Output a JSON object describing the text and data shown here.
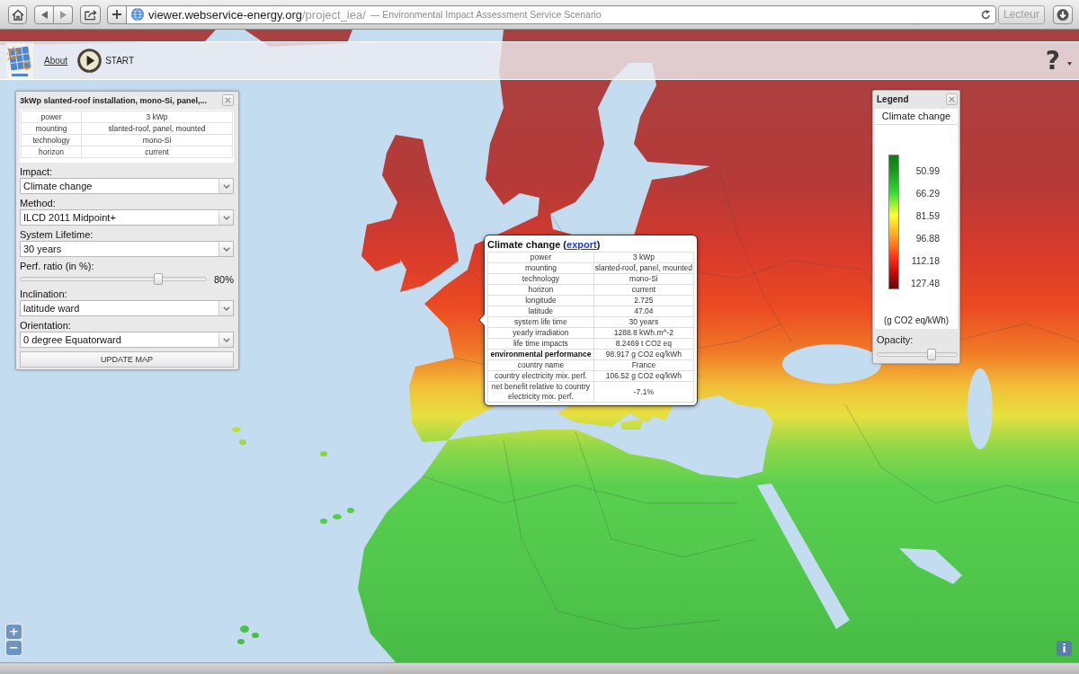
{
  "browser": {
    "address": {
      "host": "viewer.webservice-energy.org",
      "path": "/project_iea/",
      "title": "— Environmental Impact Assessment Service Scenario"
    },
    "reader_button": "Lecteur"
  },
  "header": {
    "about_link": "About",
    "start_button": "START",
    "help_button": "?"
  },
  "settings_panel": {
    "title": "3kWp slanted-roof installation, mono-Si, panel,...",
    "details": [
      {
        "name": "power",
        "value": "3 kWp"
      },
      {
        "name": "mounting",
        "value": "slanted-roof, panel, mounted"
      },
      {
        "name": "technology",
        "value": "mono-Si"
      },
      {
        "name": "horizon",
        "value": "current"
      }
    ],
    "fields": [
      {
        "kind": "select",
        "label": "Impact:",
        "value": "Climate change"
      },
      {
        "kind": "select",
        "label": "Method:",
        "value": "ILCD 2011 Midpoint+"
      },
      {
        "kind": "select",
        "label": "System Lifetime:",
        "value": "30 years"
      },
      {
        "kind": "slider",
        "label": "Perf. ratio (in %):",
        "level": 0.74,
        "reading": "80%"
      },
      {
        "kind": "select",
        "label": "Inclination:",
        "value": "latitude ward"
      },
      {
        "kind": "select",
        "label": "Orientation:",
        "value": "0 degree Equatorward"
      }
    ],
    "button": "UPDATE MAP"
  },
  "popup": {
    "title": "Climate change (",
    "link": "export",
    "title_end": ")",
    "rows": [
      {
        "name": "power",
        "value": "3 kWp",
        "bold": false
      },
      {
        "name": "mounting",
        "value": "slanted-roof, panel, mounted",
        "bold": false
      },
      {
        "name": "technology",
        "value": "mono-Si",
        "bold": false
      },
      {
        "name": "horizon",
        "value": "current",
        "bold": false
      },
      {
        "name": "longitude",
        "value": "2.725",
        "bold": false
      },
      {
        "name": "latitude",
        "value": "47.04",
        "bold": false
      },
      {
        "name": "system life time",
        "value": "30 years",
        "bold": false
      },
      {
        "name": "yearly irradiation",
        "value": "1288.8 kWh.m^-2",
        "bold": false
      },
      {
        "name": "life time impacts",
        "value": "8.2469 t CO2 eq",
        "bold": false
      },
      {
        "name": "environmental performance",
        "value": "98.917 g CO2 eq/kWh",
        "bold": true
      },
      {
        "name": "country name",
        "value": "France",
        "bold": false
      },
      {
        "name": "country electricity mix. perf.",
        "value": "106.52 g CO2 eq/kWh",
        "bold": false
      },
      {
        "name": "net benefit relative to country electricity mix. perf.",
        "value": "-7.1%",
        "bold": false
      }
    ]
  },
  "legend": {
    "title": "Legend",
    "layer": "Climate change",
    "scale": [
      "50.99",
      "66.29",
      "81.59",
      "96.88",
      "112.18",
      "127.48"
    ],
    "unit": "(g CO2 eq/kWh)",
    "opacity": {
      "label": "Opacity:",
      "level": 0.68
    }
  },
  "map_controls": {
    "zoom_in": "+",
    "zoom_out": "−",
    "info": "i"
  }
}
